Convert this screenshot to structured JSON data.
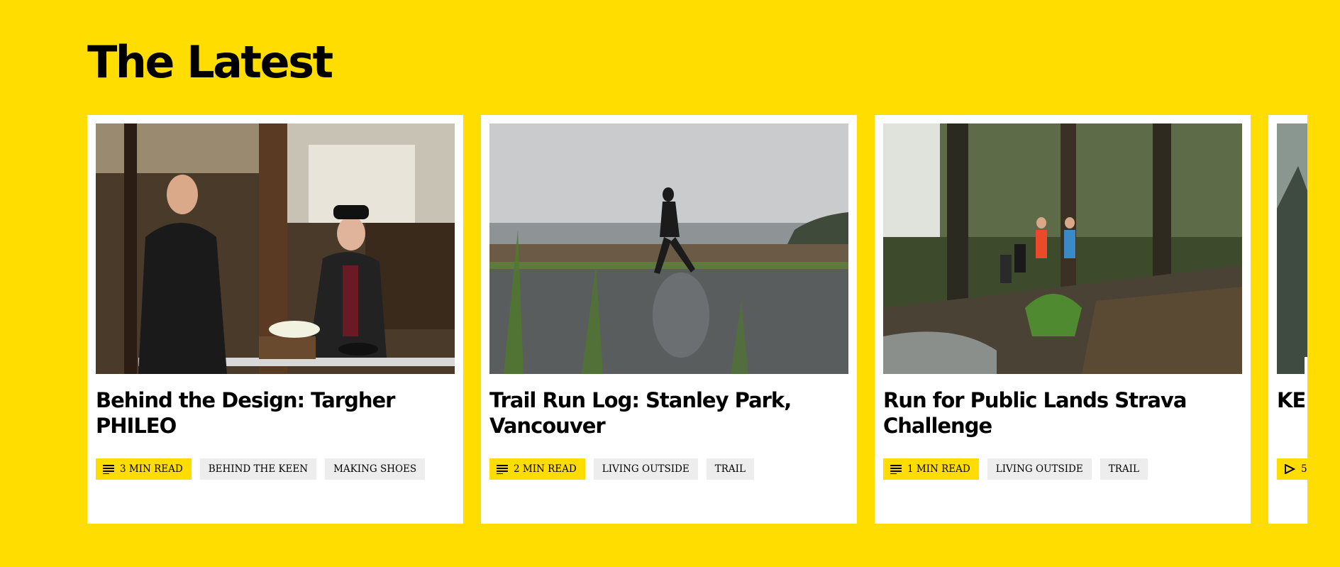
{
  "section": {
    "title": "The Latest"
  },
  "colors": {
    "background": "#FFDD00",
    "card": "#FFFFFF",
    "tag": "#EDEDED",
    "read_tag": "#FFDD00"
  },
  "cards": [
    {
      "title": "Behind the Design: Targher PHILEO",
      "read_time": "3 MIN READ",
      "read_icon": "article-lines-icon",
      "tags": [
        "BEHIND THE KEEN",
        "MAKING SHOES"
      ]
    },
    {
      "title": "Trail Run Log: Stanley Park, Vancouver",
      "read_time": "2 MIN READ",
      "read_icon": "article-lines-icon",
      "tags": [
        "LIVING OUTSIDE",
        "TRAIL"
      ]
    },
    {
      "title": "Run for Public Lands Strava Challenge",
      "read_time": "1 MIN READ",
      "read_icon": "article-lines-icon",
      "tags": [
        "LIVING OUTSIDE",
        "TRAIL"
      ]
    },
    {
      "title": "KEEN Run",
      "read_time": "5",
      "read_icon": "play-icon",
      "tags": []
    }
  ],
  "carousel": {
    "next_icon": "arrow-right-icon"
  }
}
